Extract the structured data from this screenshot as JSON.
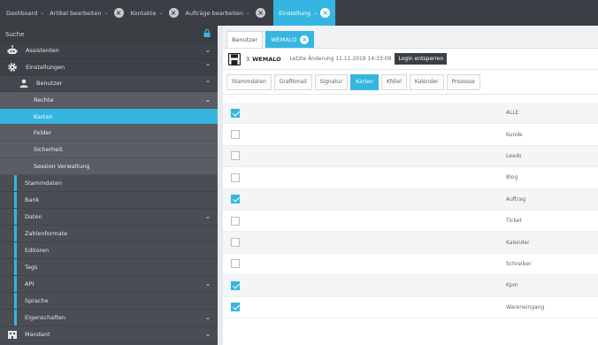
{
  "topbar": {
    "tabs": [
      {
        "label": "Dashboard"
      },
      {
        "label": "Artikel bearbeiten"
      },
      {
        "label": "Kontakte"
      },
      {
        "label": "Aufträge bearbeiten"
      }
    ],
    "active_tab": {
      "label": "Einstellung"
    }
  },
  "sidebar": {
    "search_label": "Suche",
    "items": [
      {
        "label": "Assistenten",
        "icon": "robot-icon"
      },
      {
        "label": "Einstellungen",
        "icon": "gear-icon"
      },
      {
        "label": "Benutzer",
        "icon": "user-icon"
      },
      {
        "label": "Rechte"
      },
      {
        "label": "Karten"
      },
      {
        "label": "Felder"
      },
      {
        "label": "Sicherheit"
      },
      {
        "label": "Session Verwaltung"
      },
      {
        "label": "Stammdaten"
      },
      {
        "label": "Bank"
      },
      {
        "label": "Daten"
      },
      {
        "label": "Zahlenformate"
      },
      {
        "label": "Editoren"
      },
      {
        "label": "Tags"
      },
      {
        "label": "API"
      },
      {
        "label": "Sprache"
      },
      {
        "label": "Eigenschaften"
      },
      {
        "label": "Mandant",
        "icon": "building-icon"
      }
    ]
  },
  "main": {
    "subtabs": [
      {
        "label": "Benutzer"
      },
      {
        "label": "WEMALO"
      }
    ],
    "record": {
      "id": "3",
      "name": "WEMALO",
      "last_change": "Letzte Änderung 11.11.2019 14:33:09",
      "login_button": "Login entsperren"
    },
    "field_tabs": [
      "Stammdaten",
      "Grafikmail",
      "Signatur",
      "Karten",
      "Kfdiel",
      "Kalender",
      "Prozesse"
    ],
    "active_field_tab": "Karten",
    "rows": [
      {
        "label": "ALLE",
        "checked": true
      },
      {
        "label": "Kunde",
        "checked": false
      },
      {
        "label": "Leads",
        "checked": false
      },
      {
        "label": "Blog",
        "checked": false
      },
      {
        "label": "Auftrag",
        "checked": true
      },
      {
        "label": "Ticket",
        "checked": false
      },
      {
        "label": "Kalender",
        "checked": false
      },
      {
        "label": "Schreiber",
        "checked": false
      },
      {
        "label": "Kpm",
        "checked": true
      },
      {
        "label": "Wareneingang",
        "checked": true
      }
    ]
  },
  "colors": {
    "accent": "#35b6e0",
    "topbar_bg": "#3b3f45",
    "sidebar_bg": "#4a4e54"
  }
}
